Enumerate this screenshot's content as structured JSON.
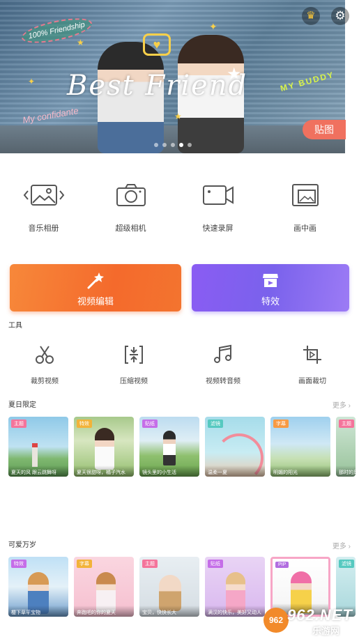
{
  "banner": {
    "title": "Best Friend",
    "tag_top_left": "100% Friendship",
    "tag_my_buddy": "MY BUDDY",
    "tag_confidante": "My confidante",
    "sticker_button": "贴图",
    "page_count": 5,
    "active_page": 4
  },
  "main_features": [
    {
      "label": "音乐相册",
      "icon": "photo-carousel-icon"
    },
    {
      "label": "超级相机",
      "icon": "camera-icon"
    },
    {
      "label": "快速录屏",
      "icon": "screen-record-icon"
    },
    {
      "label": "画中画",
      "icon": "picture-in-picture-icon"
    }
  ],
  "big_buttons": {
    "edit_label": "视频编辑",
    "effects_label": "特效"
  },
  "tools": {
    "title": "工具",
    "items": [
      {
        "label": "裁剪视频",
        "icon": "scissors-icon"
      },
      {
        "label": "压缩视频",
        "icon": "compress-icon"
      },
      {
        "label": "视频转音频",
        "icon": "music-note-icon"
      },
      {
        "label": "画面裁切",
        "icon": "crop-icon"
      }
    ]
  },
  "summary": {
    "title": "夏日限定",
    "more": "更多",
    "cards": [
      {
        "badge": "主题",
        "caption": "夏天的风 跟云跳舞呀",
        "badge_color": "#f4749b"
      },
      {
        "badge": "特效",
        "caption": "夏天很甜呀，橘子汽水",
        "badge_color": "#f2b33a"
      },
      {
        "badge": "贴纸",
        "caption": "镜头里的小生活",
        "badge_color": "#c56ee8"
      },
      {
        "badge": "滤镜",
        "caption": "温柔一夏",
        "badge_color": "#56c9c0"
      },
      {
        "badge": "字幕",
        "caption": "明媚的阳光",
        "badge_color": "#f79a43"
      },
      {
        "badge": "主题",
        "caption": "那时的风",
        "badge_color": "#f4749b"
      }
    ]
  },
  "cute": {
    "title": "可爱万岁",
    "more": "更多",
    "cards": [
      {
        "badge": "特效",
        "caption": "樱下草平宝物",
        "badge_color": "#c56ee8"
      },
      {
        "badge": "字幕",
        "caption": "奔跑吧的你的夏天",
        "badge_color": "#f2b33a"
      },
      {
        "badge": "主题",
        "caption": "宝贝，快快长大",
        "badge_color": "#f4749b"
      },
      {
        "badge": "贴纸",
        "caption": "满汉的快乐，美好又动人",
        "badge_color": "#c56ee8"
      },
      {
        "badge": "PIP",
        "caption": "",
        "badge_color": "#b26ee0"
      },
      {
        "badge": "滤镜",
        "caption": "",
        "badge_color": "#56c9c0"
      }
    ]
  },
  "watermark": {
    "main": "962.NET",
    "sub": "乐游网",
    "logo": "962"
  }
}
